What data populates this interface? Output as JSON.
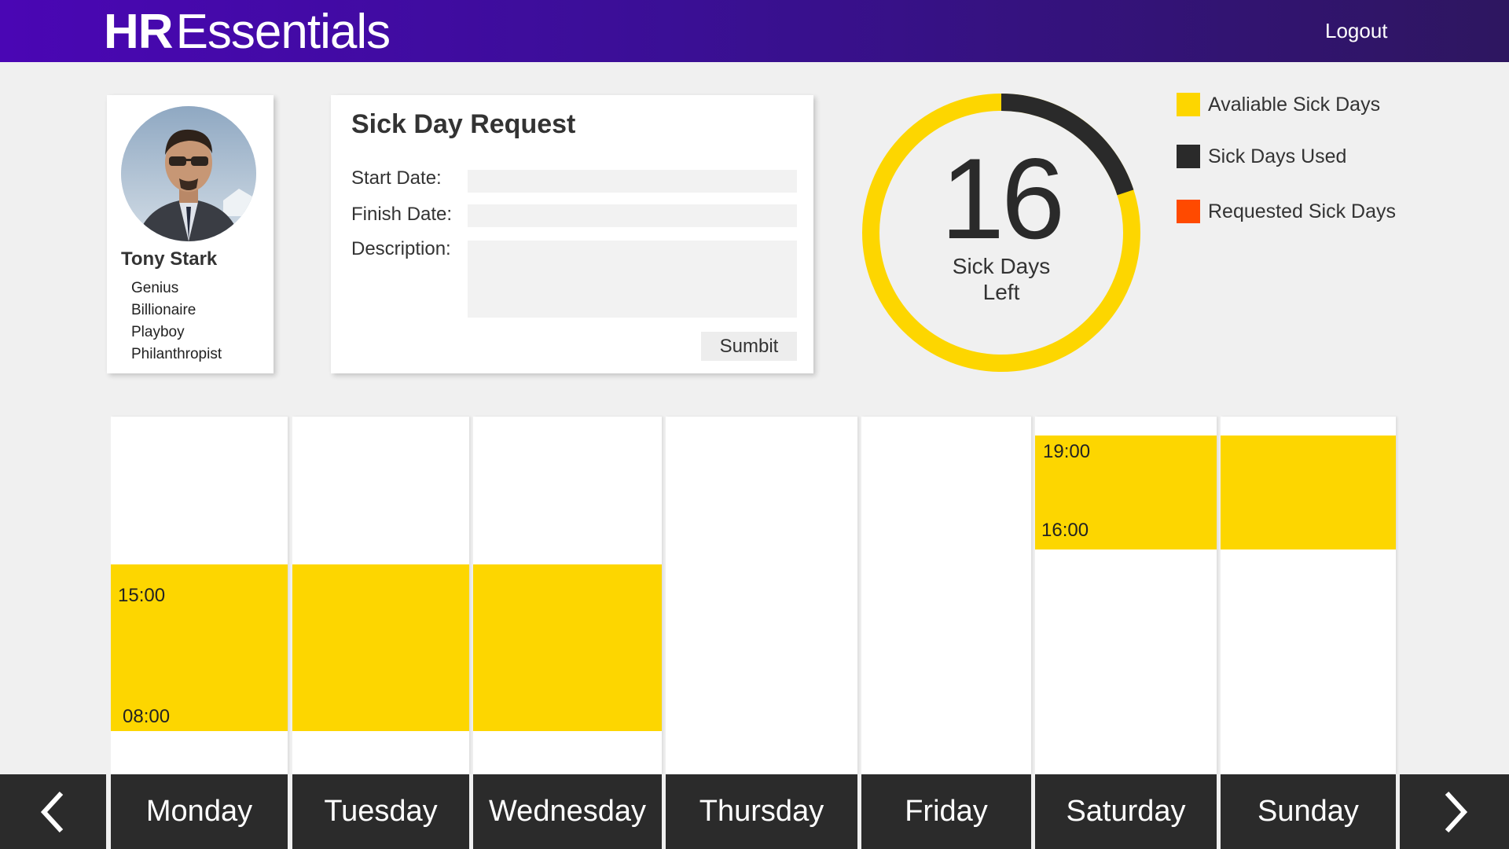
{
  "header": {
    "logo_bold": "HR",
    "logo_rest": "Essentials",
    "logout_label": "Logout"
  },
  "profile": {
    "name": "Tony Stark",
    "tags": [
      "Genius",
      "Billionaire",
      "Playboy",
      "Philanthropist"
    ]
  },
  "request_form": {
    "title": "Sick Day Request",
    "start_label": "Start Date:",
    "start_value": "",
    "finish_label": "Finish Date:",
    "finish_value": "",
    "description_label": "Description:",
    "description_value": "",
    "submit_label": "Sumbit"
  },
  "sick_days": {
    "left_value": "16",
    "caption_line1": "Sick Days",
    "caption_line2": "Left",
    "available_fraction": 0.8,
    "used_fraction": 0.2
  },
  "legend": [
    {
      "label": "Avaliable Sick Days",
      "color": "#fdd600"
    },
    {
      "label": "Sick Days Used",
      "color": "#2a2a2a"
    },
    {
      "label": "Requested Sick Days",
      "color": "#ff4a00"
    }
  ],
  "calendar": {
    "block_color": "#fdd600",
    "days": [
      {
        "label": "Monday",
        "block": {
          "start": "15:00",
          "end": "08:00"
        }
      },
      {
        "label": "Tuesday",
        "block": {
          "start": "",
          "end": ""
        }
      },
      {
        "label": "Wednesday",
        "block": {
          "start": "",
          "end": ""
        }
      },
      {
        "label": "Thursday",
        "block": null
      },
      {
        "label": "Friday",
        "block": null
      },
      {
        "label": "Saturday",
        "block": {
          "start": "19:00",
          "end": "16:00"
        }
      },
      {
        "label": "Sunday",
        "block": {
          "start": "",
          "end": ""
        }
      }
    ]
  },
  "nav": {
    "prev_icon": "chevron-left-icon",
    "next_icon": "chevron-right-icon"
  }
}
